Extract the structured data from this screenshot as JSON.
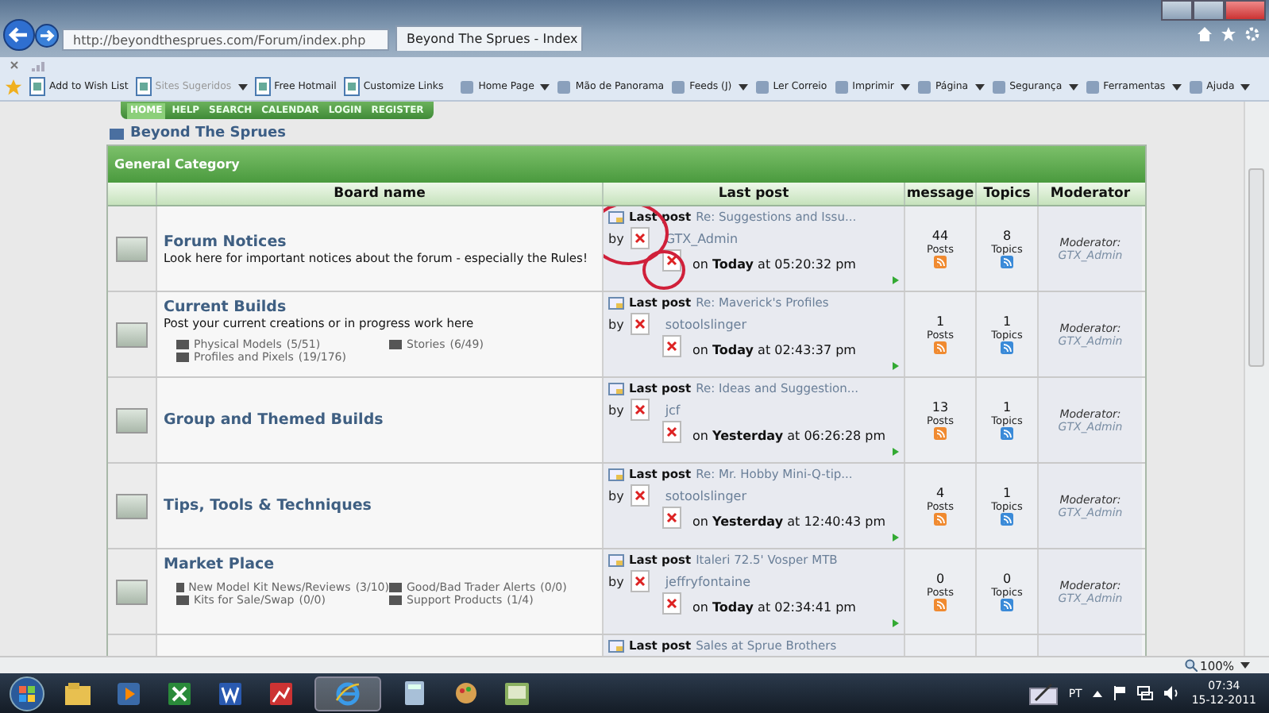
{
  "browser": {
    "address": "http://beyondthesprues.com/Forum/index.php",
    "tab_title": "Beyond The Sprues - Index",
    "favorites": [
      {
        "label": "Add to Wish List",
        "dropdown": false,
        "disabled": false
      },
      {
        "label": "Sites Sugeridos",
        "dropdown": true,
        "disabled": true
      },
      {
        "label": "Free Hotmail",
        "dropdown": false,
        "disabled": false
      },
      {
        "label": "Customize Links",
        "dropdown": false,
        "disabled": false
      }
    ],
    "commands": [
      {
        "label": "Home Page",
        "dropdown": true
      },
      {
        "label": "Mão de Panorama",
        "dropdown": false
      },
      {
        "label": "Feeds (J)",
        "dropdown": true
      },
      {
        "label": "Ler Correio",
        "dropdown": false
      },
      {
        "label": "Imprimir",
        "dropdown": true
      },
      {
        "label": "Página",
        "dropdown": true
      },
      {
        "label": "Segurança",
        "dropdown": true
      },
      {
        "label": "Ferramentas",
        "dropdown": true
      },
      {
        "label": "Ajuda",
        "dropdown": true
      }
    ],
    "zoom": "100%"
  },
  "forum": {
    "nav": [
      {
        "label": "HOME",
        "selected": true
      },
      {
        "label": "HELP",
        "selected": false
      },
      {
        "label": "SEARCH",
        "selected": false
      },
      {
        "label": "CALENDAR",
        "selected": false
      },
      {
        "label": "LOGIN",
        "selected": false
      },
      {
        "label": "REGISTER",
        "selected": false
      }
    ],
    "title": "Beyond The Sprues",
    "category": "General Category",
    "columns": [
      "Board name",
      "Last post",
      "message",
      "Topics",
      "Moderator"
    ],
    "boards": [
      {
        "name": "Forum Notices",
        "description": "Look here for important notices about the forum - especially the Rules!",
        "last_post_label": "Last post",
        "last_post_title": "Re: Suggestions and Issu...",
        "by": "by",
        "user": "GTX_Admin",
        "when": "on **Today** at 05:20:32 pm",
        "posts": "44",
        "posts_label": "Posts",
        "topics": "8",
        "topics_label": "Topics",
        "moderator_label": "Moderator:",
        "moderator": "GTX_Admin",
        "circled": true
      },
      {
        "name": "Current Builds",
        "description": "Post your current creations or in progress work here",
        "subboards": [
          {
            "name": "Physical Models",
            "count": "(5/51)"
          },
          {
            "name": "Stories",
            "count": "(6/49)"
          },
          {
            "name": "Profiles and Pixels",
            "count": "(19/176)"
          }
        ],
        "last_post_label": "Last post",
        "last_post_title": "Re: Maverick's Profiles",
        "by": "by",
        "user": "sotoolslinger",
        "when": "on **Today** at 02:43:37 pm",
        "posts": "1",
        "posts_label": "Posts",
        "topics": "1",
        "topics_label": "Topics",
        "moderator_label": "Moderator:",
        "moderator": "GTX_Admin",
        "circled": false
      },
      {
        "name": "Group and Themed Builds",
        "last_post_label": "Last post",
        "last_post_title": "Re: Ideas and Suggestion...",
        "by": "by",
        "user": "jcf",
        "when": "on **Yesterday** at 06:26:28 pm",
        "posts": "13",
        "posts_label": "Posts",
        "topics": "1",
        "topics_label": "Topics",
        "moderator_label": "Moderator:",
        "moderator": "GTX_Admin",
        "circled": false
      },
      {
        "name": "Tips, Tools & Techniques",
        "last_post_label": "Last post",
        "last_post_title": "Re: Mr. Hobby Mini-Q-tip...",
        "by": "by",
        "user": "sotoolslinger",
        "when": "on **Yesterday** at 12:40:43 pm",
        "posts": "4",
        "posts_label": "Posts",
        "topics": "1",
        "topics_label": "Topics",
        "moderator_label": "Moderator:",
        "moderator": "GTX_Admin",
        "circled": false
      },
      {
        "name": "Market Place",
        "subboards": [
          {
            "name": "New Model Kit News/Reviews",
            "count": "(3/10)"
          },
          {
            "name": "Good/Bad Trader Alerts",
            "count": "(0/0)"
          },
          {
            "name": "Kits for Sale/Swap",
            "count": "(0/0)"
          },
          {
            "name": "Support Products",
            "count": "(1/4)"
          }
        ],
        "last_post_label": "Last post",
        "last_post_title": "Italeri 72.5' Vosper MTB",
        "by": "by",
        "user": "jeffryfontaine",
        "when": "on **Today** at 02:34:41 pm",
        "posts": "0",
        "posts_label": "Posts",
        "topics": "0",
        "topics_label": "Topics",
        "moderator_label": "Moderator:",
        "moderator": "GTX_Admin",
        "circled": false
      },
      {
        "last_post_label": "Last post",
        "last_post_title": "Sales at Sprue Brothers",
        "circled": false
      }
    ]
  },
  "taskbar": {
    "language": "PT",
    "time": "07:34",
    "date": "15-12-2011"
  }
}
